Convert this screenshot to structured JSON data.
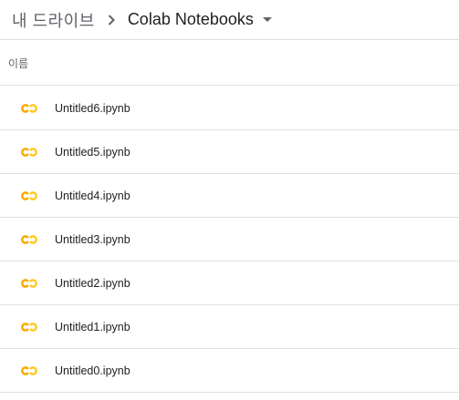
{
  "breadcrumb": {
    "root_label": "내 드라이브",
    "separator_icon": "chevron-right-icon",
    "current_folder": "Colab Notebooks",
    "caret_icon": "caret-down-icon"
  },
  "list": {
    "column_header": "이름",
    "file_icon": "colab-icon",
    "colors": {
      "colab_orange": "#F9AB00",
      "colab_yellow": "#FFCA28"
    },
    "files": [
      {
        "name": "Untitled6.ipynb"
      },
      {
        "name": "Untitled5.ipynb"
      },
      {
        "name": "Untitled4.ipynb"
      },
      {
        "name": "Untitled3.ipynb"
      },
      {
        "name": "Untitled2.ipynb"
      },
      {
        "name": "Untitled1.ipynb"
      },
      {
        "name": "Untitled0.ipynb"
      }
    ]
  }
}
